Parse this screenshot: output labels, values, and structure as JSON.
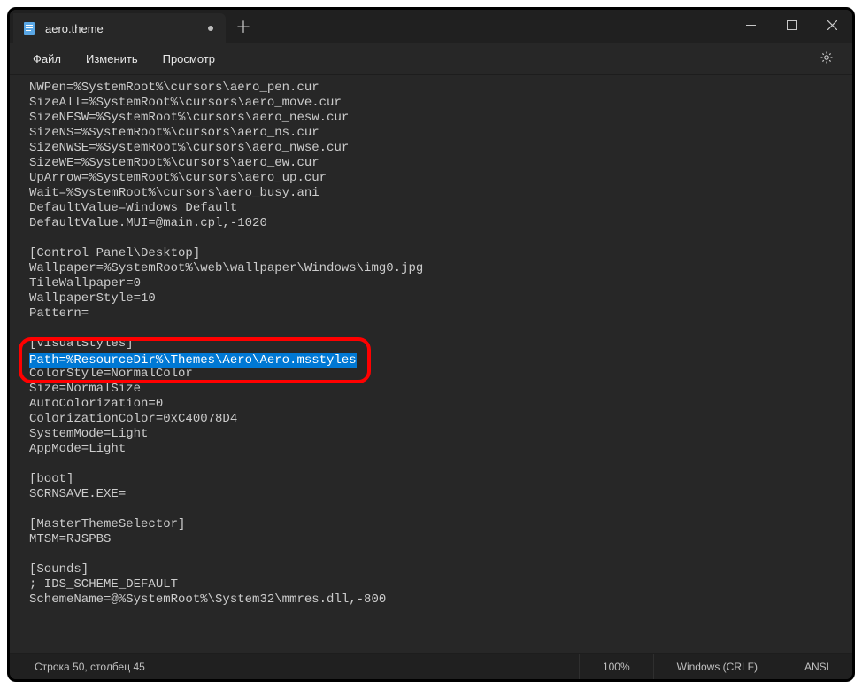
{
  "titlebar": {
    "tab_title": "aero.theme"
  },
  "menu": {
    "file": "Файл",
    "edit": "Изменить",
    "view": "Просмотр"
  },
  "editor": {
    "lines": [
      "NWPen=%SystemRoot%\\cursors\\aero_pen.cur",
      "SizeAll=%SystemRoot%\\cursors\\aero_move.cur",
      "SizeNESW=%SystemRoot%\\cursors\\aero_nesw.cur",
      "SizeNS=%SystemRoot%\\cursors\\aero_ns.cur",
      "SizeNWSE=%SystemRoot%\\cursors\\aero_nwse.cur",
      "SizeWE=%SystemRoot%\\cursors\\aero_ew.cur",
      "UpArrow=%SystemRoot%\\cursors\\aero_up.cur",
      "Wait=%SystemRoot%\\cursors\\aero_busy.ani",
      "DefaultValue=Windows Default",
      "DefaultValue.MUI=@main.cpl,-1020",
      "",
      "[Control Panel\\Desktop]",
      "Wallpaper=%SystemRoot%\\web\\wallpaper\\Windows\\img0.jpg",
      "TileWallpaper=0",
      "WallpaperStyle=10",
      "Pattern=",
      "",
      "[VisualStyles]",
      "Path=%ResourceDir%\\Themes\\Aero\\Aero.msstyles",
      "ColorStyle=NormalColor",
      "Size=NormalSize",
      "AutoColorization=0",
      "ColorizationColor=0xC40078D4",
      "SystemMode=Light",
      "AppMode=Light",
      "",
      "[boot]",
      "SCRNSAVE.EXE=",
      "",
      "[MasterThemeSelector]",
      "MTSM=RJSPBS",
      "",
      "[Sounds]",
      "; IDS_SCHEME_DEFAULT",
      "SchemeName=@%SystemRoot%\\System32\\mmres.dll,-800"
    ],
    "highlighted_index": 18
  },
  "status": {
    "position": "Строка 50, столбец 45",
    "zoom": "100%",
    "eol": "Windows (CRLF)",
    "encoding": "ANSI"
  }
}
